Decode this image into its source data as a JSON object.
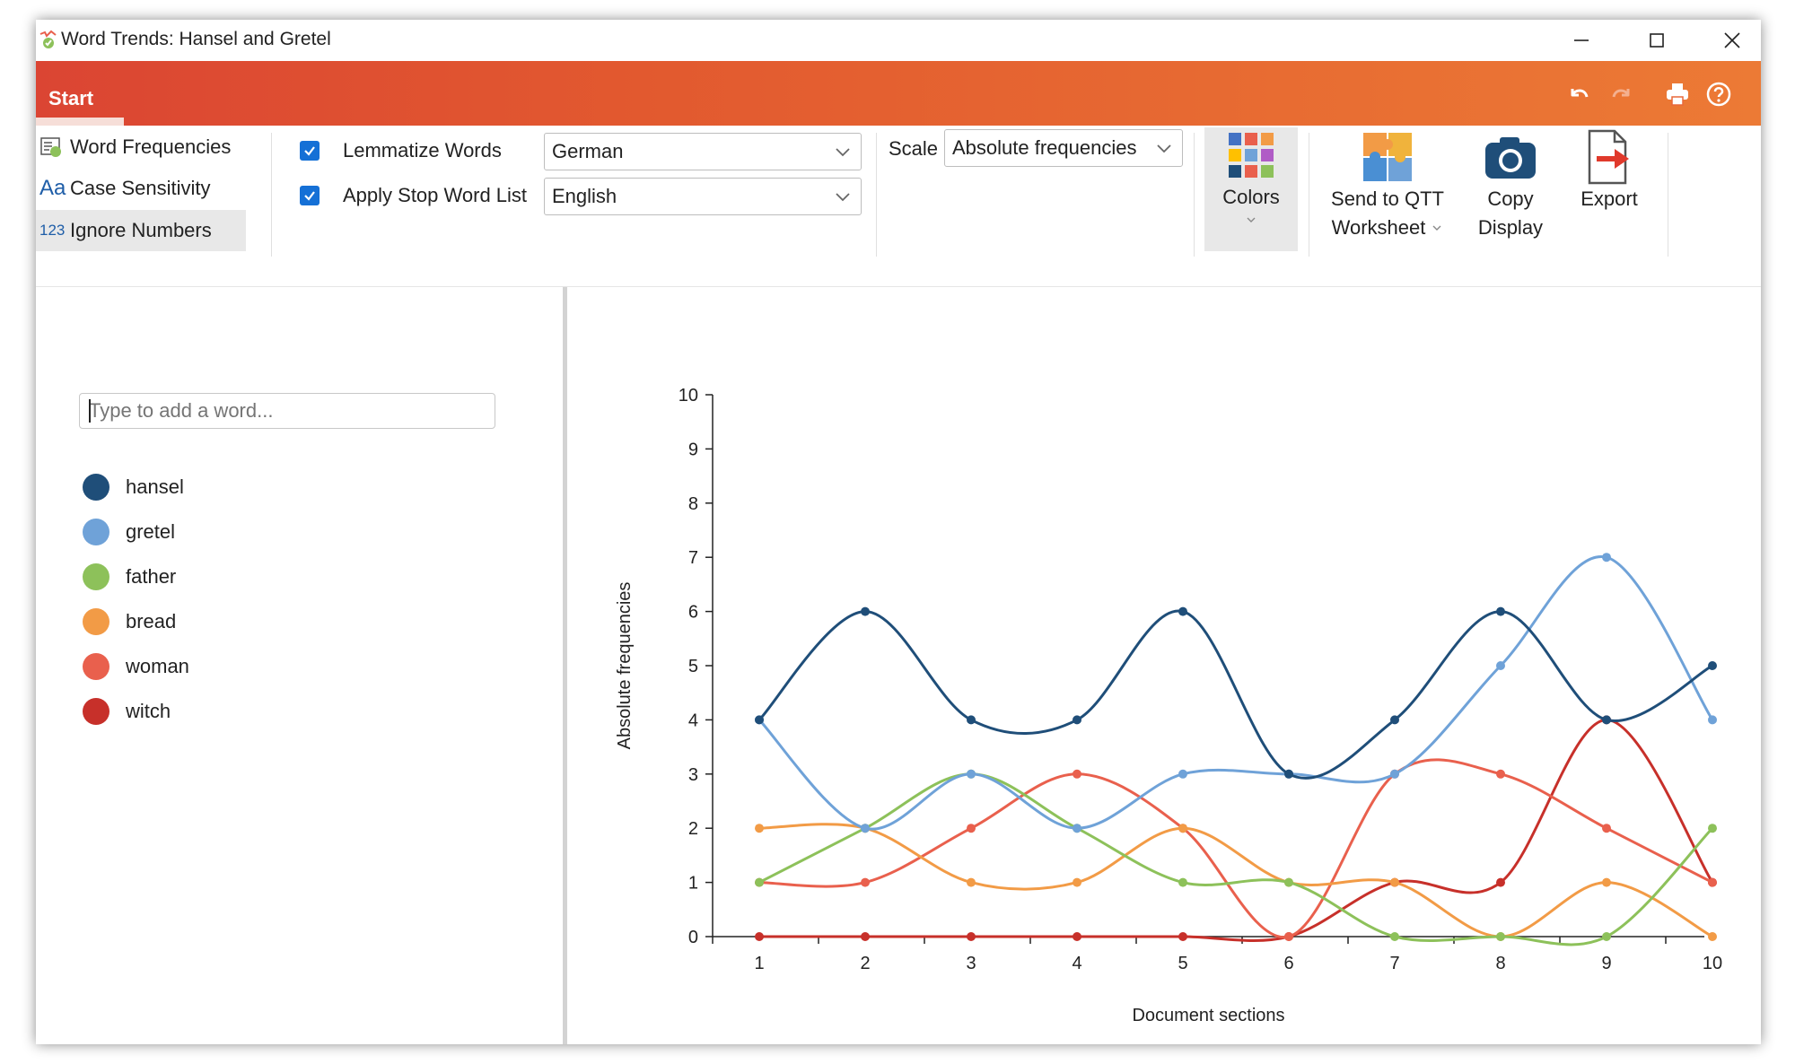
{
  "window": {
    "title": "Word Trends: Hansel and Gretel"
  },
  "ribbon": {
    "tab": "Start",
    "left_items": [
      "Word Frequencies",
      "Case Sensitivity",
      "Ignore Numbers"
    ],
    "left_icon_labels": [
      "Aa",
      "123"
    ],
    "lemmatize_label": "Lemmatize Words",
    "lemmatize_checked": true,
    "lemmatize_language": "German",
    "stopword_label": "Apply Stop Word List",
    "stopword_checked": true,
    "stopword_language": "English",
    "scale_label": "Scale",
    "scale_value": "Absolute frequencies",
    "colors_label": "Colors",
    "send_label_1": "Send to QTT",
    "send_label_2": "Worksheet",
    "copy_label_1": "Copy",
    "copy_label_2": "Display",
    "export_label": "Export",
    "icons": [
      "undo-icon",
      "redo-icon",
      "print-icon",
      "help-icon"
    ]
  },
  "left_panel": {
    "input_placeholder": "Type to add a word...",
    "words": [
      {
        "label": "hansel",
        "color": "#1f4e79"
      },
      {
        "label": "gretel",
        "color": "#6fa2d8"
      },
      {
        "label": "father",
        "color": "#8dc15a"
      },
      {
        "label": "bread",
        "color": "#f29b46"
      },
      {
        "label": "woman",
        "color": "#e9604d"
      },
      {
        "label": "witch",
        "color": "#c7302a"
      }
    ]
  },
  "chart_data": {
    "type": "line",
    "xlabel": "Document sections",
    "ylabel": "Absolute frequencies",
    "x": [
      1,
      2,
      3,
      4,
      5,
      6,
      7,
      8,
      9,
      10
    ],
    "ylim": [
      0,
      10
    ],
    "yticks": [
      0,
      1,
      2,
      3,
      4,
      5,
      6,
      7,
      8,
      9,
      10
    ],
    "grid": false,
    "legend": "left panel",
    "series": [
      {
        "name": "hansel",
        "color": "#1f4e79",
        "values": [
          4,
          6,
          4,
          4,
          6,
          3,
          4,
          6,
          4,
          5
        ]
      },
      {
        "name": "gretel",
        "color": "#6fa2d8",
        "values": [
          4,
          2,
          3,
          2,
          3,
          3,
          3,
          5,
          7,
          4
        ]
      },
      {
        "name": "father",
        "color": "#8dc15a",
        "values": [
          1,
          2,
          3,
          2,
          1,
          1,
          0,
          0,
          0,
          2
        ]
      },
      {
        "name": "bread",
        "color": "#f29b46",
        "values": [
          2,
          2,
          1,
          1,
          2,
          1,
          1,
          0,
          1,
          0
        ]
      },
      {
        "name": "woman",
        "color": "#e9604d",
        "values": [
          1,
          1,
          2,
          3,
          2,
          0,
          3,
          3,
          2,
          1
        ]
      },
      {
        "name": "witch",
        "color": "#c7302a",
        "values": [
          0,
          0,
          0,
          0,
          0,
          0,
          1,
          1,
          4,
          1
        ]
      }
    ]
  }
}
